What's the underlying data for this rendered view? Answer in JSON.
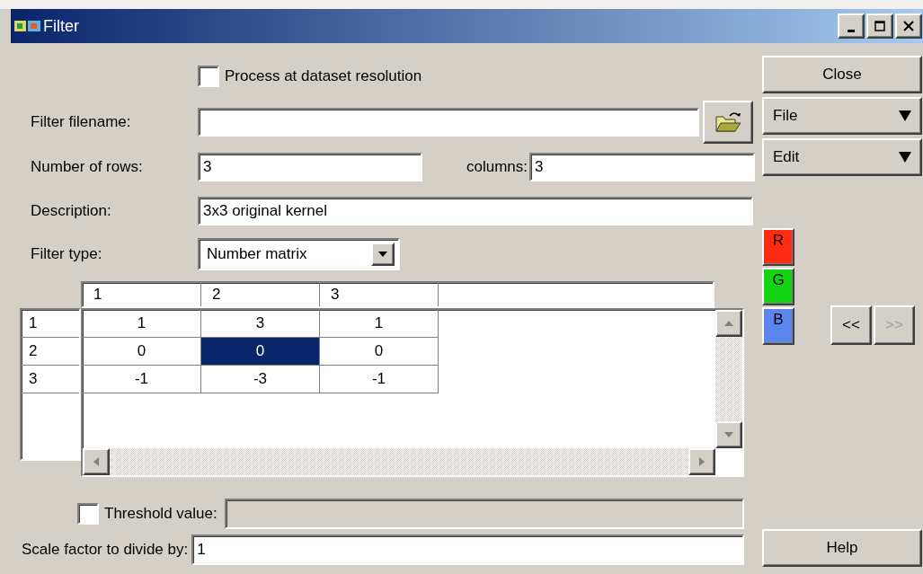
{
  "window": {
    "title": "Filter"
  },
  "process_at_dataset_resolution": {
    "label": "Process at dataset resolution",
    "checked": false
  },
  "filter_filename": {
    "label": "Filter filename:"
  },
  "number_of_rows": {
    "label": "Number of rows:",
    "value": "3"
  },
  "columns": {
    "label": "columns:",
    "value": "3"
  },
  "description": {
    "label": "Description:",
    "value": "3x3 original kernel"
  },
  "filter_type": {
    "label": "Filter type:",
    "value": "Number matrix"
  },
  "matrix": {
    "columns": [
      "1",
      "2",
      "3"
    ],
    "rows": [
      {
        "header": "1",
        "cells": [
          {
            "value": "1",
            "selected": false
          },
          {
            "value": "3",
            "selected": false
          },
          {
            "value": "1",
            "selected": false
          }
        ]
      },
      {
        "header": "2",
        "cells": [
          {
            "value": "0",
            "selected": false
          },
          {
            "value": "0",
            "selected": true
          },
          {
            "value": "0",
            "selected": false
          }
        ]
      },
      {
        "header": "3",
        "cells": [
          {
            "value": "-1",
            "selected": false
          },
          {
            "value": "-3",
            "selected": false
          },
          {
            "value": "-1",
            "selected": false
          }
        ]
      }
    ]
  },
  "threshold": {
    "label": "Threshold value:",
    "checked": false,
    "disabled": true
  },
  "scale_factor": {
    "label": "Scale factor to divide by:",
    "value": "1"
  },
  "buttons": {
    "close": "Close",
    "file": "File",
    "edit": "Edit",
    "help": "Help"
  },
  "channels": [
    {
      "label": "R",
      "color": "#ff2a10"
    },
    {
      "label": "G",
      "color": "#12d412"
    },
    {
      "label": "B",
      "color": "#5b86f0"
    }
  ],
  "nav": [
    {
      "label": "<<",
      "disabled": false
    },
    {
      "label": ">>",
      "disabled": true
    }
  ]
}
